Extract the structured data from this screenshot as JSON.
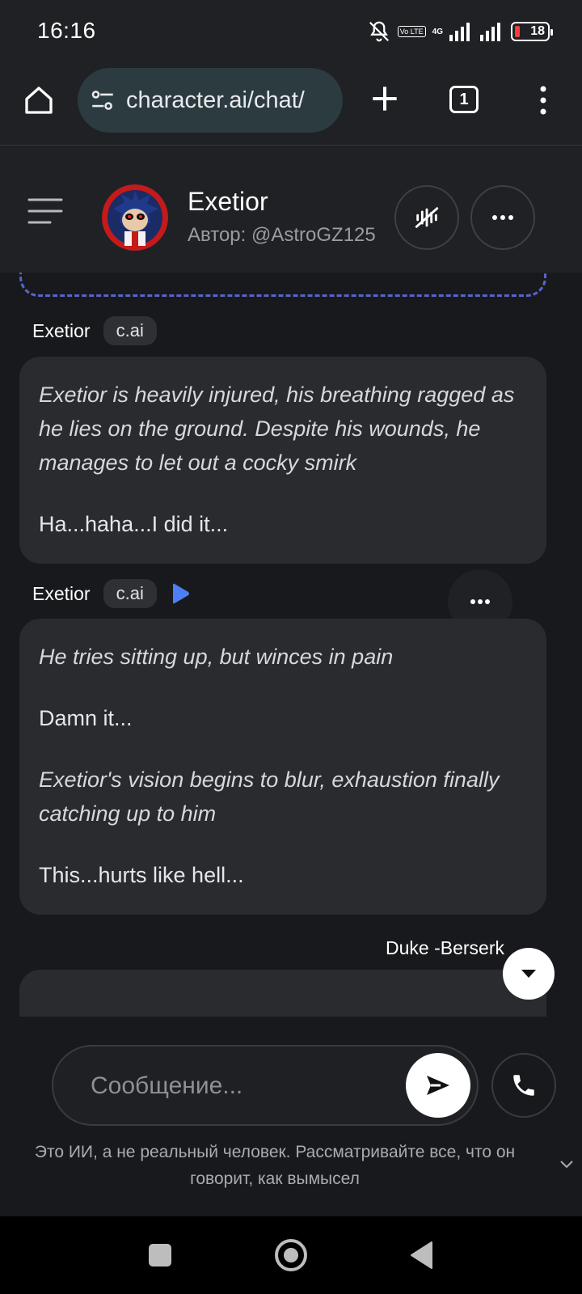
{
  "status": {
    "time": "16:16",
    "network": "4G",
    "volte": "Vo LTE",
    "battery": "18"
  },
  "browser": {
    "url": "character.ai/chat/",
    "tab_count": "1"
  },
  "header": {
    "name": "Exetior",
    "author": "Автор: @AstroGZ125"
  },
  "messages": [
    {
      "sender": "Exetior",
      "badge": "c.ai",
      "paragraphs": [
        "Exetior is heavily injured, his breathing ragged as he lies on the ground. Despite his wounds, he manages to let out a cocky smirk",
        "Ha...haha...I did it..."
      ]
    },
    {
      "sender": "Exetior",
      "badge": "c.ai",
      "paragraphs": [
        "He tries sitting up, but winces in pain",
        "Damn it...",
        "Exetior's vision begins to blur, exhaustion finally catching up to him",
        "This...hurts like hell..."
      ]
    },
    {
      "sender": "Duke -Berserk"
    }
  ],
  "composer": {
    "placeholder": "Сообщение..."
  },
  "disclaimer": "Это ИИ, а не реальный человек. Рассматривайте все, что он говорит, как вымысел",
  "colors": {
    "background": "#18191c",
    "bubble": "#2a2b2f",
    "accent_play": "#4f7df3",
    "dashed_border": "#5864c9",
    "battery_low": "#ff3b3b"
  },
  "icons": [
    "bell-off-icon",
    "signal-icon",
    "battery-icon",
    "home-icon",
    "site-settings-icon",
    "plus-icon",
    "tabs-icon",
    "kebab-menu-icon",
    "hamburger-icon",
    "voice-off-icon",
    "more-icon",
    "play-icon",
    "chevron-down-icon",
    "send-icon",
    "phone-icon",
    "chevron-down-small-icon"
  ]
}
